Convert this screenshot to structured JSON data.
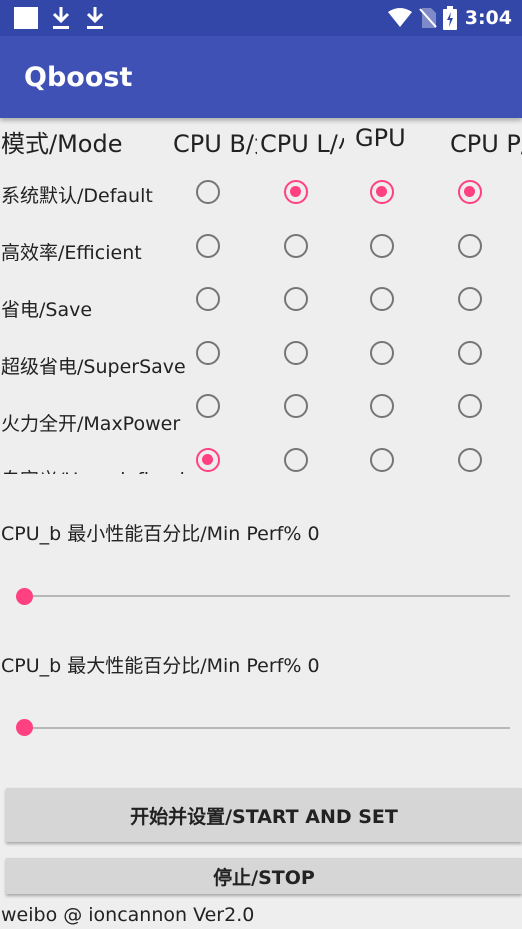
{
  "status_bar": {
    "time": "3:04"
  },
  "app": {
    "title": "Qboost"
  },
  "table": {
    "columns": [
      "模式/Mode",
      "CPU B/大核",
      "CPU L/小核",
      "GPU",
      "CPU P/超核"
    ],
    "rows": [
      {
        "label": "系统默认/Default",
        "selected": [
          false,
          true,
          true,
          true
        ]
      },
      {
        "label": "高效率/Efficient",
        "selected": [
          false,
          false,
          false,
          false
        ]
      },
      {
        "label": "省电/Save",
        "selected": [
          false,
          false,
          false,
          false
        ]
      },
      {
        "label": "超级省电/SuperSave",
        "selected": [
          false,
          false,
          false,
          false
        ]
      },
      {
        "label": "火力全开/MaxPower",
        "selected": [
          false,
          false,
          false,
          false
        ]
      },
      {
        "label": "自定义/User-defined",
        "selected": [
          true,
          false,
          false,
          false
        ]
      }
    ]
  },
  "sliders": [
    {
      "label": "CPU_b 最小性能百分比/Min Perf% 0",
      "value": 0
    },
    {
      "label": "CPU_b 最大性能百分比/Min Perf% 0",
      "value": 0
    }
  ],
  "buttons": {
    "start": "开始并设置/START AND SET",
    "stop": "停止/STOP"
  },
  "footer": "weibo @ ioncannon Ver2.0"
}
